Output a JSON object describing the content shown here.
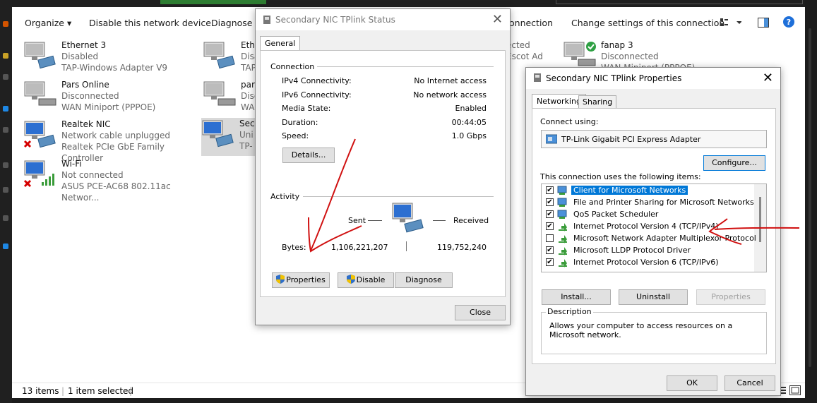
{
  "toolbar": {
    "organize": "Organize ▾",
    "disable": "Disable this network device",
    "diagnose": "Diagnose th",
    "connection": "onnection",
    "change": "Change settings of this connection"
  },
  "network_items": [
    {
      "name": "Ethernet 3",
      "status": "Disabled",
      "device": "TAP-Windows Adapter V9"
    },
    {
      "name": "Pars Online",
      "status": "Disconnected",
      "device": "WAN Miniport (PPPOE)"
    },
    {
      "name": "Realtek NIC",
      "status": "Network cable unplugged",
      "device": "Realtek PCIe GbE Family Controller"
    },
    {
      "name": "Wi-Fi",
      "status": "Not connected",
      "device": "ASUS PCE-AC68 802.11ac Networ..."
    },
    {
      "name": "Ethe",
      "status": "Disa",
      "device": "TAP"
    },
    {
      "name": "pars",
      "status": "Disc",
      "device": "WA"
    },
    {
      "name": "Seco",
      "status": "Uni",
      "device": "TP-"
    },
    {
      "name": "fanap 3",
      "status": "Disconnected",
      "device": "WAN Miniport (PPPOE)"
    },
    {
      "name": "",
      "status": "ected",
      "device": "Escot Ad"
    }
  ],
  "statusbar": {
    "items": "13 items",
    "selected": "1 item selected"
  },
  "status_dialog": {
    "title": "Secondary NIC TPlink Status",
    "tab": "General",
    "connection_header": "Connection",
    "rows": [
      {
        "label": "IPv4 Connectivity:",
        "value": "No Internet access"
      },
      {
        "label": "IPv6 Connectivity:",
        "value": "No network access"
      },
      {
        "label": "Media State:",
        "value": "Enabled"
      },
      {
        "label": "Duration:",
        "value": "00:44:05"
      },
      {
        "label": "Speed:",
        "value": "1.0 Gbps"
      }
    ],
    "details_button": "Details...",
    "activity_header": "Activity",
    "sent_label": "Sent",
    "received_label": "Received",
    "bytes_label": "Bytes:",
    "bytes_sent": "1,106,221,207",
    "bytes_received": "119,752,240",
    "properties_button": "Properties",
    "disable_button": "Disable",
    "diagnose_button": "Diagnose",
    "close_button": "Close"
  },
  "properties_dialog": {
    "title": "Secondary NIC TPlink Properties",
    "tab_networking": "Networking",
    "tab_sharing": "Sharing",
    "connect_using_label": "Connect using:",
    "adapter_name": "TP-Link Gigabit PCI Express Adapter",
    "configure_button": "Configure...",
    "items_label": "This connection uses the following items:",
    "items": [
      {
        "label": "Client for Microsoft Networks",
        "checked": true,
        "icon": "network-client-icon"
      },
      {
        "label": "File and Printer Sharing for Microsoft Networks",
        "checked": true,
        "icon": "network-service-icon"
      },
      {
        "label": "QoS Packet Scheduler",
        "checked": true,
        "icon": "network-service-icon"
      },
      {
        "label": "Internet Protocol Version 4 (TCP/IPv4)",
        "checked": true,
        "icon": "protocol-icon"
      },
      {
        "label": "Microsoft Network Adapter Multiplexor Protocol",
        "checked": false,
        "icon": "protocol-icon"
      },
      {
        "label": "Microsoft LLDP Protocol Driver",
        "checked": true,
        "icon": "protocol-icon"
      },
      {
        "label": "Internet Protocol Version 6 (TCP/IPv6)",
        "checked": true,
        "icon": "protocol-icon"
      }
    ],
    "install_button": "Install...",
    "uninstall_button": "Uninstall",
    "properties_button": "Properties",
    "description_header": "Description",
    "description_text": "Allows your computer to access resources on a Microsoft network.",
    "ok_button": "OK",
    "cancel_button": "Cancel"
  },
  "colors": {
    "accent": "#0078d7",
    "annotation_red": "#d01010",
    "check_green": "#2ea043"
  }
}
